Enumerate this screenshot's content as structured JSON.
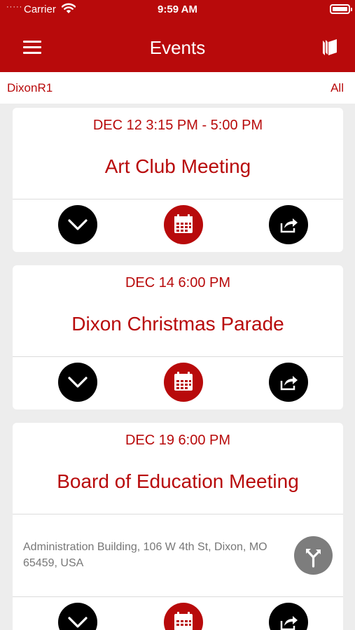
{
  "status_bar": {
    "carrier": "Carrier",
    "time": "9:59 AM",
    "signal_glyph": "·····",
    "icons": [
      "wifi-icon",
      "battery-icon"
    ]
  },
  "header": {
    "title": "Events",
    "menu_icon": "hamburger-menu-icon",
    "right_icon": "book-icon",
    "color": "#b80a0b"
  },
  "filter": {
    "district": "DixonR1",
    "scope": "All"
  },
  "events": [
    {
      "date": "DEC 12 3:15 PM - 5:00 PM",
      "name": "Art Club Meeting",
      "actions": [
        "expand-icon",
        "calendar-icon",
        "share-icon"
      ]
    },
    {
      "date": "DEC 14 6:00 PM",
      "name": "Dixon Christmas Parade",
      "actions": [
        "expand-icon",
        "calendar-icon",
        "share-icon"
      ]
    },
    {
      "date": "DEC 19 6:00 PM",
      "name": "Board of Education Meeting",
      "address": "Administration Building, 106 W 4th St, Dixon, MO 65459, USA",
      "location_icon": "directions-icon",
      "actions": [
        "expand-icon",
        "calendar-icon",
        "share-icon"
      ]
    }
  ],
  "colors": {
    "accent": "#b80a0b",
    "background": "#ededed",
    "card": "#ffffff",
    "address_text": "#777777",
    "directions_button": "#7d7d7d"
  }
}
